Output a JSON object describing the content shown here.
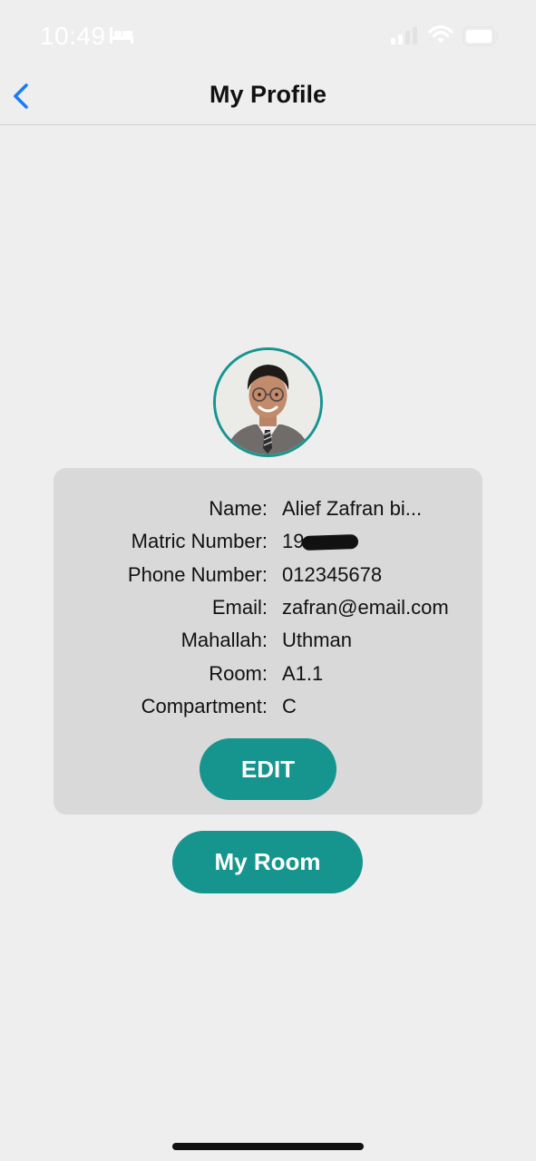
{
  "status_bar": {
    "time": "10:49",
    "icons": [
      "bed-icon",
      "signal-icon",
      "wifi-icon",
      "battery-icon"
    ]
  },
  "nav": {
    "title": "My Profile",
    "back_icon": "chevron-left-icon"
  },
  "profile": {
    "avatar": "profile-photo",
    "fields": [
      {
        "label": "Name:",
        "value": "Alief Zafran bi..."
      },
      {
        "label": "Matric Number:",
        "value": "19",
        "redacted": true
      },
      {
        "label": "Phone Number:",
        "value": "012345678"
      },
      {
        "label": "Email:",
        "value": "zafran@email.com"
      },
      {
        "label": "Mahallah:",
        "value": "Uthman"
      },
      {
        "label": "Room:",
        "value": "A1.1"
      },
      {
        "label": "Compartment:",
        "value": "C"
      }
    ]
  },
  "buttons": {
    "edit_label": "EDIT",
    "my_room_label": "My Room"
  },
  "colors": {
    "accent": "#16958f",
    "background": "#eeeeee",
    "card": "#d9d9d9",
    "back_icon": "#1a7cf5"
  }
}
